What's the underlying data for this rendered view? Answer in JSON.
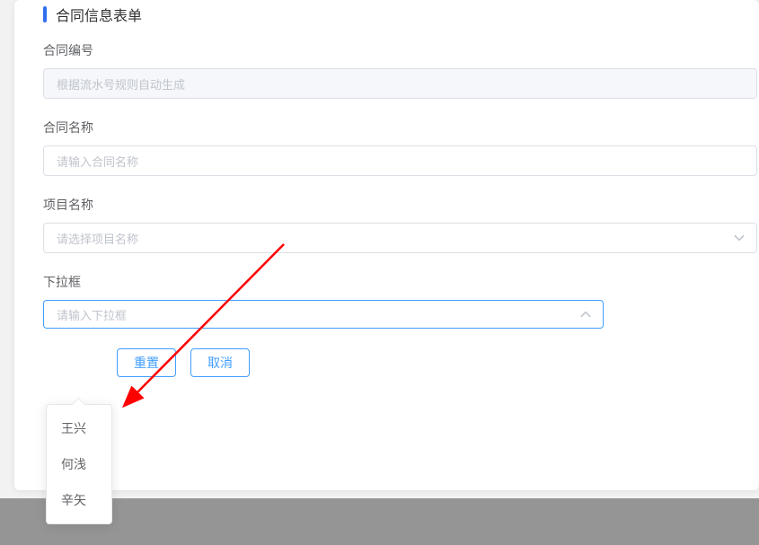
{
  "form": {
    "title": "合同信息表单",
    "fields": {
      "contract_no": {
        "label": "合同编号",
        "placeholder": "根据流水号规则自动生成",
        "disabled": true
      },
      "contract_name": {
        "label": "合同名称",
        "placeholder": "请输入合同名称"
      },
      "project_name": {
        "label": "项目名称",
        "placeholder": "请选择项目名称"
      },
      "dropdown": {
        "label": "下拉框",
        "placeholder": "请输入下拉框",
        "expanded": true,
        "options": [
          "王兴",
          "何浅",
          "辛矢"
        ]
      }
    },
    "buttons": {
      "reset": "重置",
      "cancel": "取消"
    }
  }
}
